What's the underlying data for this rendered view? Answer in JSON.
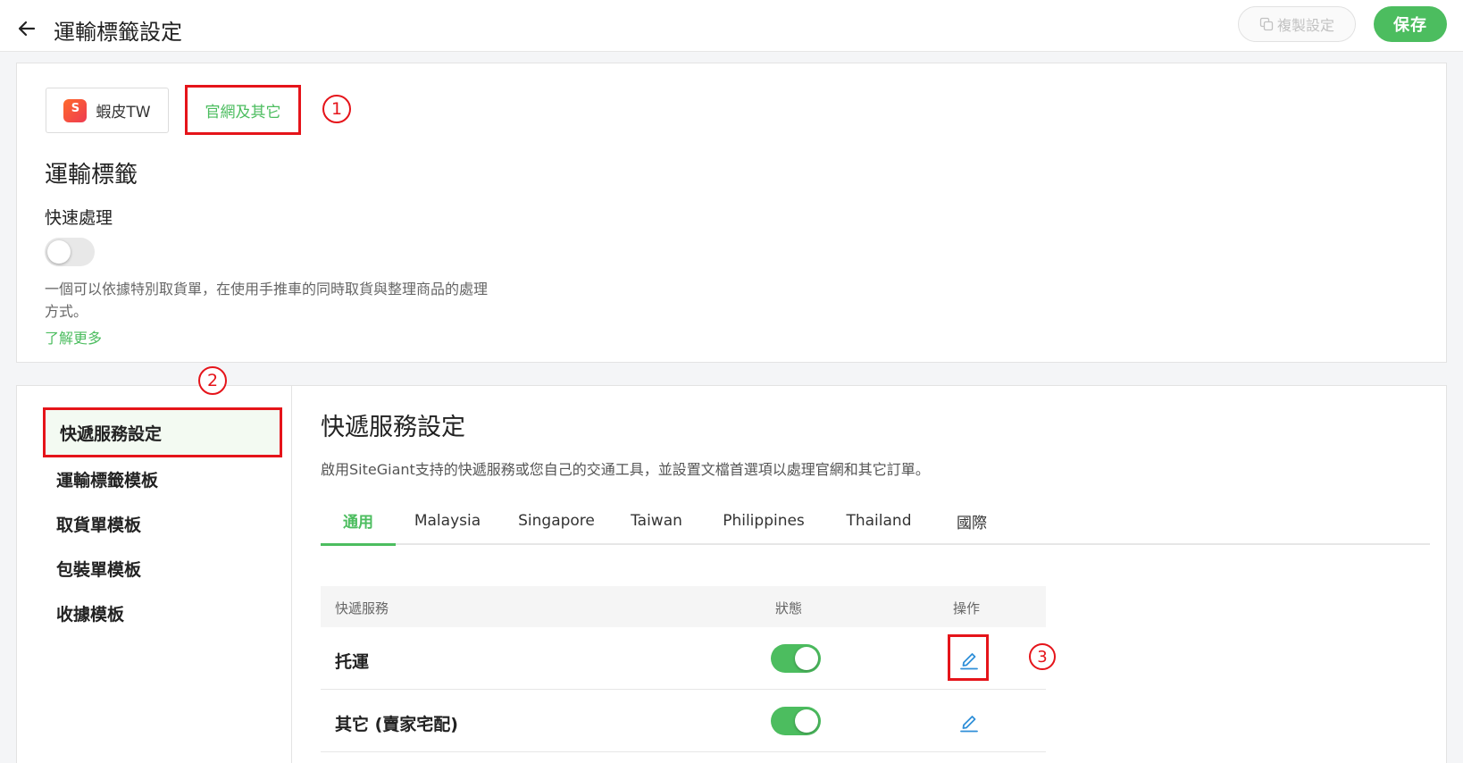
{
  "header": {
    "title": "運輸標籤設定",
    "copy_label": "複製設定",
    "save_label": "保存"
  },
  "channels": {
    "shopee_label": "蝦皮TW",
    "web_label": "官網及其它"
  },
  "annotations": [
    "1",
    "2",
    "3"
  ],
  "shipping_label": {
    "title": "運輸標籤",
    "fast_process_label": "快速處理",
    "fast_process_enabled": false,
    "description": "一個可以依據特別取貨單，在使用手推車的同時取貨與整理商品的處理方式。",
    "learn_more": "了解更多"
  },
  "sidebar": {
    "items": [
      {
        "label": "快遞服務設定",
        "active": true
      },
      {
        "label": "運輸標籤模板",
        "active": false
      },
      {
        "label": "取貨單模板",
        "active": false
      },
      {
        "label": "包裝單模板",
        "active": false
      },
      {
        "label": "收據模板",
        "active": false
      }
    ]
  },
  "main": {
    "title": "快遞服務設定",
    "description": "啟用SiteGiant支持的快遞服務或您自己的交通工具，並設置文檔首選項以處理官網和其它訂單。",
    "tabs": [
      {
        "label": "通用",
        "active": true
      },
      {
        "label": "Malaysia",
        "active": false
      },
      {
        "label": "Singapore",
        "active": false
      },
      {
        "label": "Taiwan",
        "active": false
      },
      {
        "label": "Philippines",
        "active": false
      },
      {
        "label": "Thailand",
        "active": false
      },
      {
        "label": "國際",
        "active": false
      }
    ],
    "table": {
      "headers": [
        "快遞服務",
        "狀態",
        "操作"
      ],
      "rows": [
        {
          "name": "托運",
          "enabled": true
        },
        {
          "name": "其它 (賣家宅配)",
          "enabled": true
        }
      ]
    }
  },
  "colors": {
    "accent": "#4cbd5f",
    "annotation": "#e5141a",
    "edit_icon": "#2f8fd8"
  }
}
